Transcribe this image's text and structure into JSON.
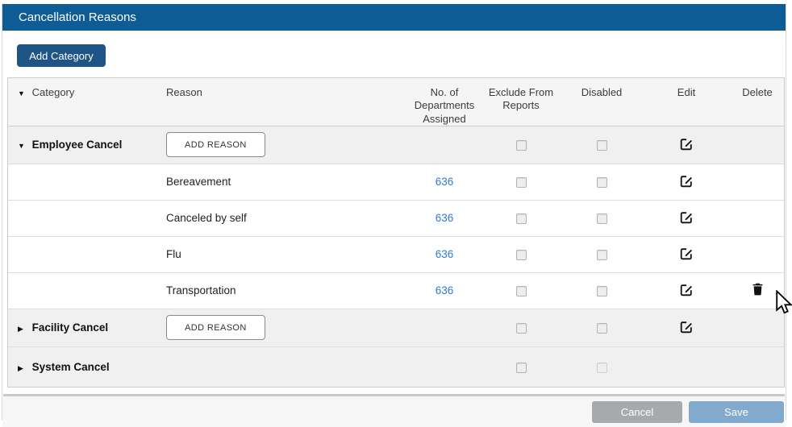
{
  "panel": {
    "title": "Cancellation Reasons"
  },
  "toolbar": {
    "add_category_label": "Add Category"
  },
  "icons": {
    "caret_down": "▼",
    "caret_right": "▶"
  },
  "table": {
    "columns": {
      "category": "Category",
      "reason": "Reason",
      "departments_line1": "No. of",
      "departments_line2": "Departments",
      "departments_line3": "Assigned",
      "exclude_line1": "Exclude From",
      "exclude_line2": "Reports",
      "disabled": "Disabled",
      "edit": "Edit",
      "delete": "Delete"
    },
    "rows": [
      {
        "type": "category",
        "label": "Employee Cancel",
        "expanded": true,
        "add_reason_label": "ADD REASON",
        "exclude_checked": false,
        "disabled_checked": false,
        "has_edit": true
      },
      {
        "type": "reason",
        "label": "Bereavement",
        "departments": "636",
        "exclude_checked": false,
        "disabled_checked": false,
        "has_edit": true
      },
      {
        "type": "reason",
        "label": "Canceled by self",
        "departments": "636",
        "exclude_checked": false,
        "disabled_checked": false,
        "has_edit": true
      },
      {
        "type": "reason",
        "label": "Flu",
        "departments": "636",
        "exclude_checked": false,
        "disabled_checked": false,
        "has_edit": true
      },
      {
        "type": "reason",
        "label": "Transportation",
        "departments": "636",
        "exclude_checked": false,
        "disabled_checked": false,
        "has_edit": true,
        "delete_visible": true,
        "cursor_visible": true
      },
      {
        "type": "category",
        "label": "Facility Cancel",
        "expanded": false,
        "add_reason_label": "ADD REASON",
        "exclude_checked": false,
        "disabled_checked": false,
        "has_edit": true
      },
      {
        "type": "category",
        "label": "System Cancel",
        "expanded": false,
        "exclude_checked": false,
        "disabled_checked": false,
        "has_edit": false
      }
    ]
  },
  "footer": {
    "cancel_label": "Cancel",
    "save_label": "Save"
  },
  "colors": {
    "titlebar_bg": "#0d5c96",
    "add_category_bg": "#1f5487",
    "link_blue": "#3179d8",
    "category_row_bg": "#f0f0f0",
    "cancel_button_bg": "#a6aaad",
    "save_button_bg": "#81aace"
  }
}
